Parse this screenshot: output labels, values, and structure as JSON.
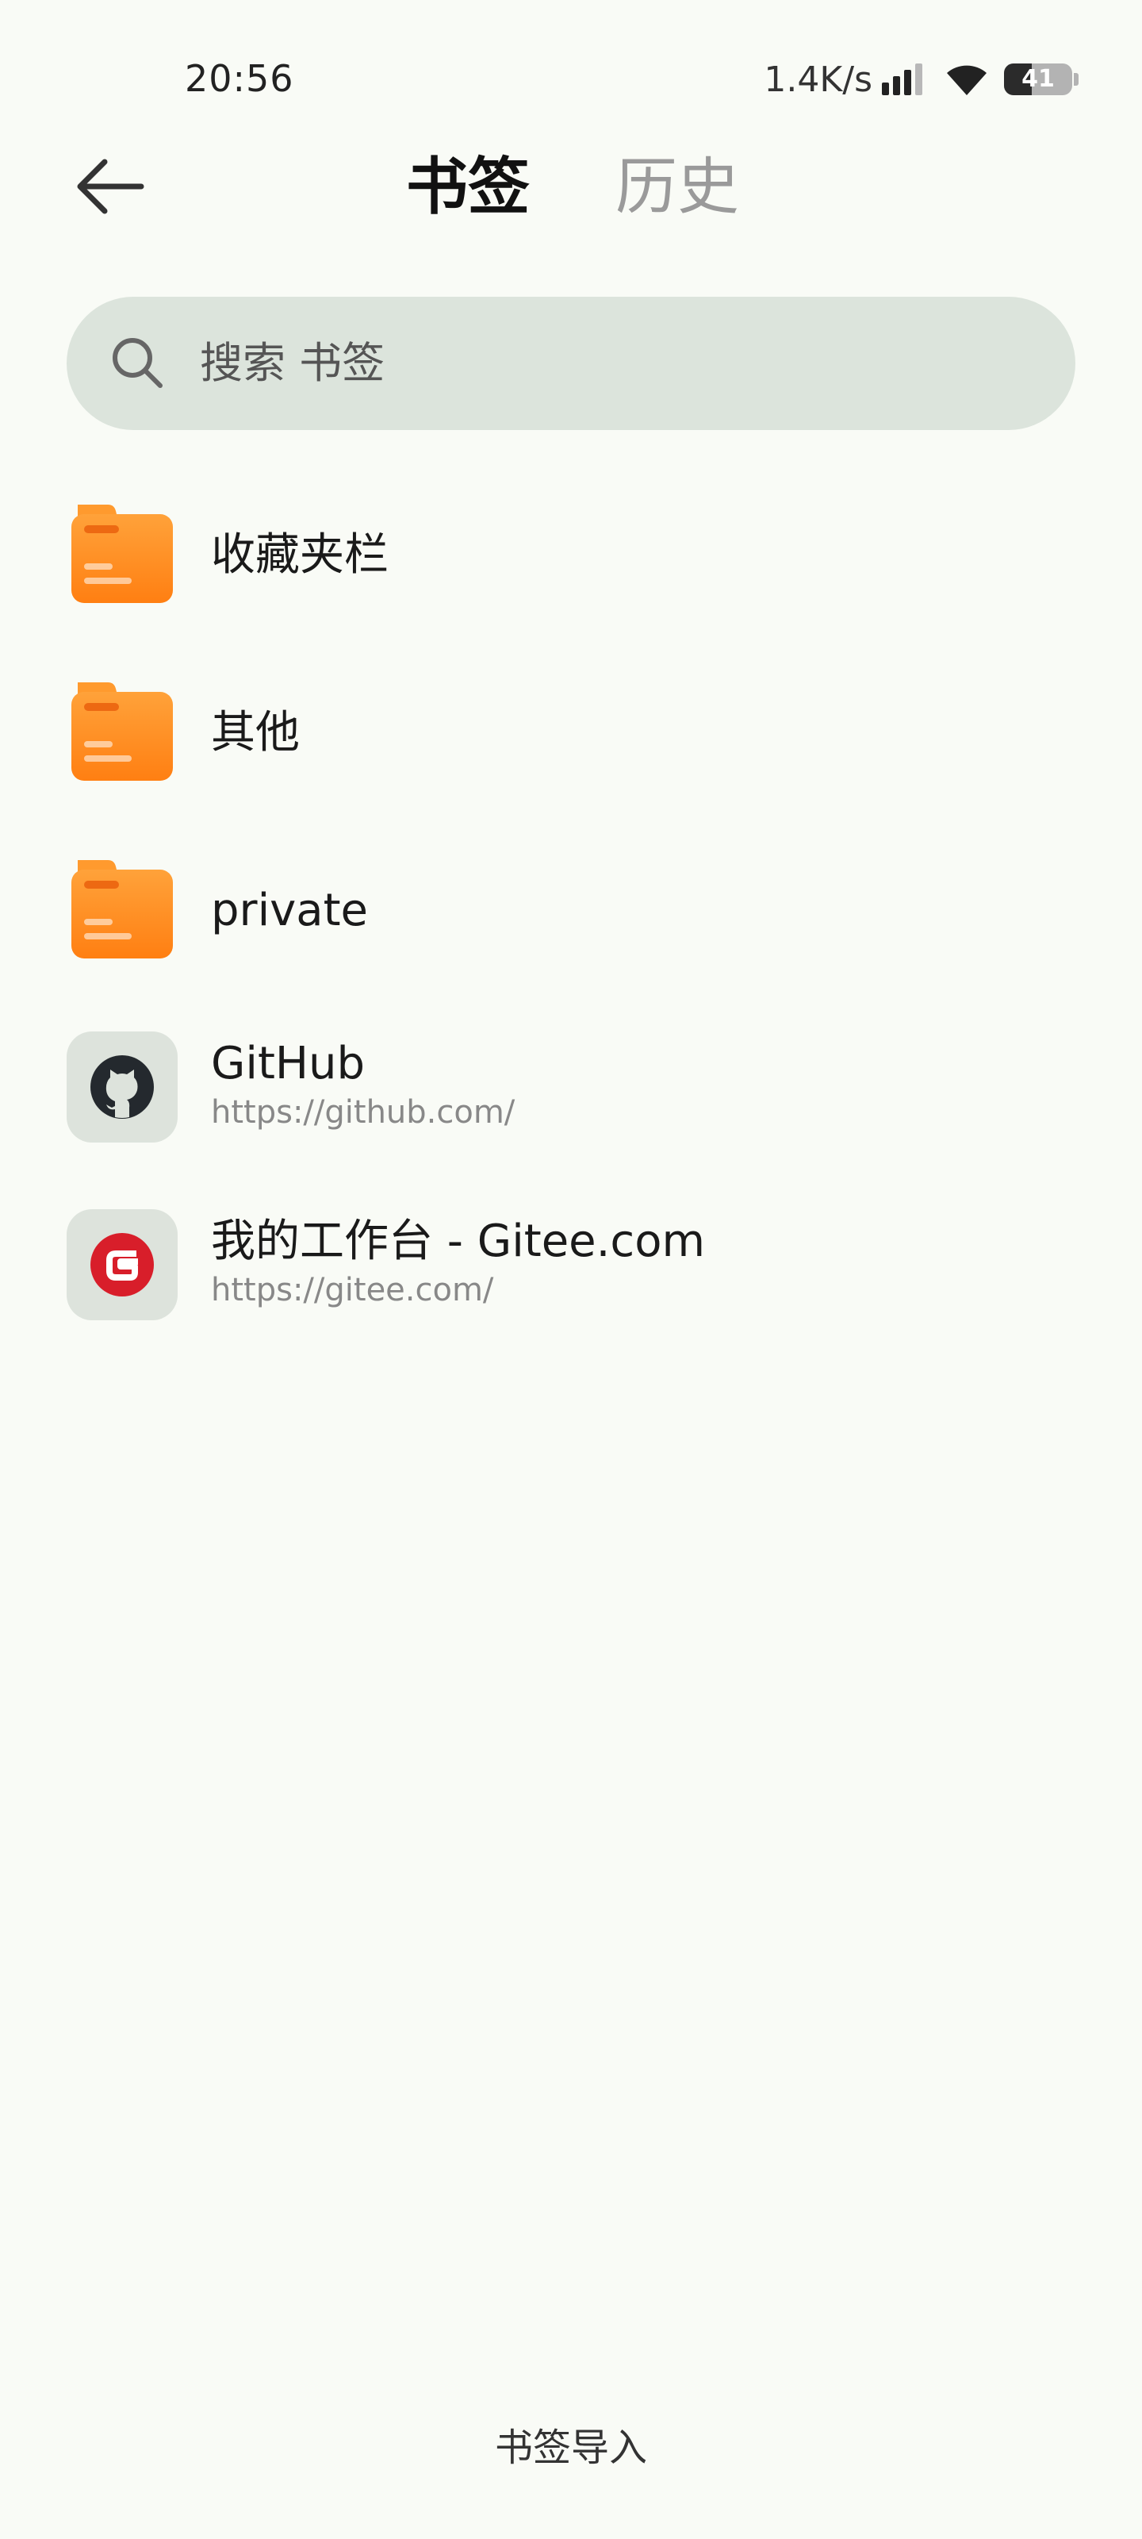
{
  "status_bar": {
    "time": "20:56",
    "net_speed": "1.4K/s",
    "battery_level": "41",
    "battery_fraction": 0.41
  },
  "header": {
    "back_icon": "arrow-left-icon",
    "tabs": [
      {
        "label": "书签",
        "active": true
      },
      {
        "label": "历史",
        "active": false
      }
    ]
  },
  "search": {
    "icon": "search-icon",
    "placeholder": "搜索 书签"
  },
  "folders": [
    {
      "title": "收藏夹栏",
      "icon": "folder-icon"
    },
    {
      "title": "其他",
      "icon": "folder-icon"
    },
    {
      "title": "private",
      "icon": "folder-icon"
    }
  ],
  "bookmarks": [
    {
      "title": "GitHub",
      "url": "https://github.com/",
      "icon": "github-icon"
    },
    {
      "title": "我的工作台 - Gitee.com",
      "url": "https://gitee.com/",
      "icon": "gitee-icon"
    }
  ],
  "footer": {
    "import_label": "书签导入"
  },
  "colors": {
    "background": "#f9fbf6",
    "search_bg": "#dce4dc",
    "folder_orange": "#ff8a1f",
    "gitee_red": "#d81e2a"
  }
}
